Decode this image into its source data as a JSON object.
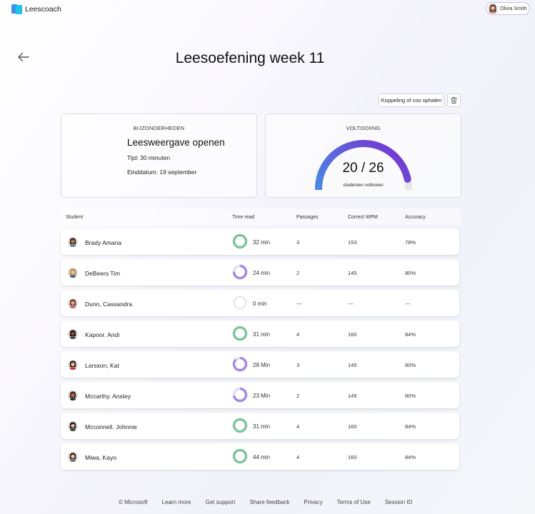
{
  "app": {
    "name": "Leescoach"
  },
  "user": {
    "name": "Olivia Smith"
  },
  "page": {
    "title": "Leesoefening week 11"
  },
  "actions": {
    "link_button": "Koppeling of coo ophalen"
  },
  "details": {
    "heading": "BIJZONDERHEDEN",
    "title": "Leesweergave openen",
    "time": "Tijd: 30 minuten",
    "due_date": "Einddatum: 19 september"
  },
  "completion": {
    "heading": "VOLTOOIING",
    "completed": 20,
    "total": 26,
    "value_text": "20 / 26",
    "caption": "studenten voltooien"
  },
  "table": {
    "headers": [
      "Student",
      "Time read",
      "Passages",
      "Correct WPM",
      "Accuracy"
    ],
    "rows": [
      {
        "student": "Brady Amana",
        "time": "32 min",
        "progress": 1.0,
        "passages": "3",
        "wpm": "153",
        "accuracy": "78%",
        "skin": "#b07a5a",
        "hair": "#3a2a22",
        "shirt": "#6a7a8a"
      },
      {
        "student": "DeBeers Tim",
        "time": "24 min",
        "progress": 0.75,
        "passages": "2",
        "wpm": "145",
        "accuracy": "80%",
        "skin": "#e8c4a4",
        "hair": "#b88848",
        "shirt": "#3d5a80"
      },
      {
        "student": "Dunn, Cassandra",
        "time": "0 min",
        "progress": 0.0,
        "passages": "---",
        "wpm": "---",
        "accuracy": "---",
        "skin": "#d8a890",
        "hair": "#6a3a2a",
        "shirt": "#c46a7a"
      },
      {
        "student": "Kapoor. Andi",
        "time": "31 min",
        "progress": 1.0,
        "passages": "4",
        "wpm": "160",
        "accuracy": "84%",
        "skin": "#7a5040",
        "hair": "#1e1410",
        "shirt": "#4a4a4a"
      },
      {
        "student": "Larsson, Kat",
        "time": "28 Min",
        "progress": 0.88,
        "passages": "3",
        "wpm": "145",
        "accuracy": "80%",
        "skin": "#e8b8a0",
        "hair": "#2a1a1a",
        "shirt": "#c83030"
      },
      {
        "student": "Mccarthy. Anstey",
        "time": "23 Min",
        "progress": 0.72,
        "passages": "2",
        "wpm": "145",
        "accuracy": "80%",
        "skin": "#a86a50",
        "hair": "#3a2218",
        "shirt": "#2a2a2a"
      },
      {
        "student": "Mcconnell. Johnnie",
        "time": "31 min",
        "progress": 1.0,
        "passages": "4",
        "wpm": "160",
        "accuracy": "84%",
        "skin": "#e0b8a0",
        "hair": "#1a1410",
        "shirt": "#444444"
      },
      {
        "student": "Miwa, Kayo",
        "time": "44 min",
        "progress": 1.0,
        "passages": "4",
        "wpm": "160",
        "accuracy": "84%",
        "skin": "#e8c8b0",
        "hair": "#2a2220",
        "shirt": "#707070"
      }
    ]
  },
  "footer": {
    "links": [
      "© Microsoft",
      "Learn more",
      "Get support",
      "Share feedback",
      "Privacy",
      "Terms of Use",
      "Session ID"
    ]
  },
  "colors": {
    "ring_full": "#7cc69a",
    "ring_partial": "#a98ae0",
    "ring_empty": "#e2dbf4",
    "gauge_start": "#3aa6ea",
    "gauge_end": "#7a2ccf",
    "gauge_track": "#e6e6e6",
    "logo_back": "#3d8fe8",
    "logo_front": "#1dc3e8"
  }
}
